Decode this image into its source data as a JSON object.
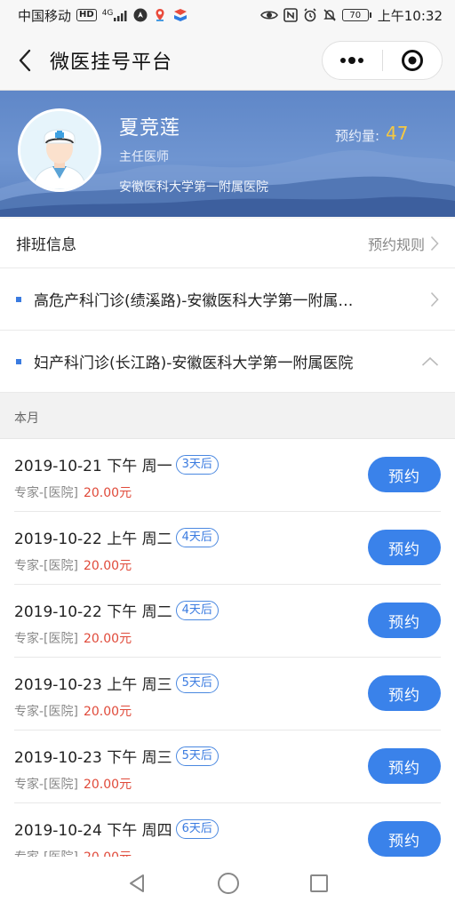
{
  "status_bar": {
    "carrier": "中国移动",
    "hd": "HD",
    "network": "4G",
    "battery": "70",
    "time": "上午10:32"
  },
  "nav": {
    "title": "微医挂号平台"
  },
  "doctor": {
    "name": "夏竞莲",
    "title": "主任医师",
    "hospital": "安徽医科大学第一附属医院",
    "appointment_label": "预约量:",
    "appointment_count": "47"
  },
  "schedule_row": {
    "label": "排班信息",
    "rules_link": "预约规则"
  },
  "departments": [
    {
      "name": "高危产科门诊(绩溪路)-安徽医科大学第一附属…",
      "expanded": false
    },
    {
      "name": "妇产科门诊(长江路)-安徽医科大学第一附属医院",
      "expanded": true
    }
  ],
  "month_label": "本月",
  "slots": [
    {
      "date": "2019-10-21 下午 周一",
      "tag": "3天后",
      "type": "专家-[医院]",
      "price": "20.00元",
      "button": "预约"
    },
    {
      "date": "2019-10-22 上午 周二",
      "tag": "4天后",
      "type": "专家-[医院]",
      "price": "20.00元",
      "button": "预约"
    },
    {
      "date": "2019-10-22 下午 周二",
      "tag": "4天后",
      "type": "专家-[医院]",
      "price": "20.00元",
      "button": "预约"
    },
    {
      "date": "2019-10-23 上午 周三",
      "tag": "5天后",
      "type": "专家-[医院]",
      "price": "20.00元",
      "button": "预约"
    },
    {
      "date": "2019-10-23 下午 周三",
      "tag": "5天后",
      "type": "专家-[医院]",
      "price": "20.00元",
      "button": "预约"
    },
    {
      "date": "2019-10-24 下午 周四",
      "tag": "6天后",
      "type": "专家-[医院]",
      "price": "20.00元",
      "button": "预约"
    }
  ],
  "colors": {
    "accent": "#3a82ea",
    "price": "#e04a3a",
    "count": "#f5c842",
    "header": "#6f95d1"
  }
}
